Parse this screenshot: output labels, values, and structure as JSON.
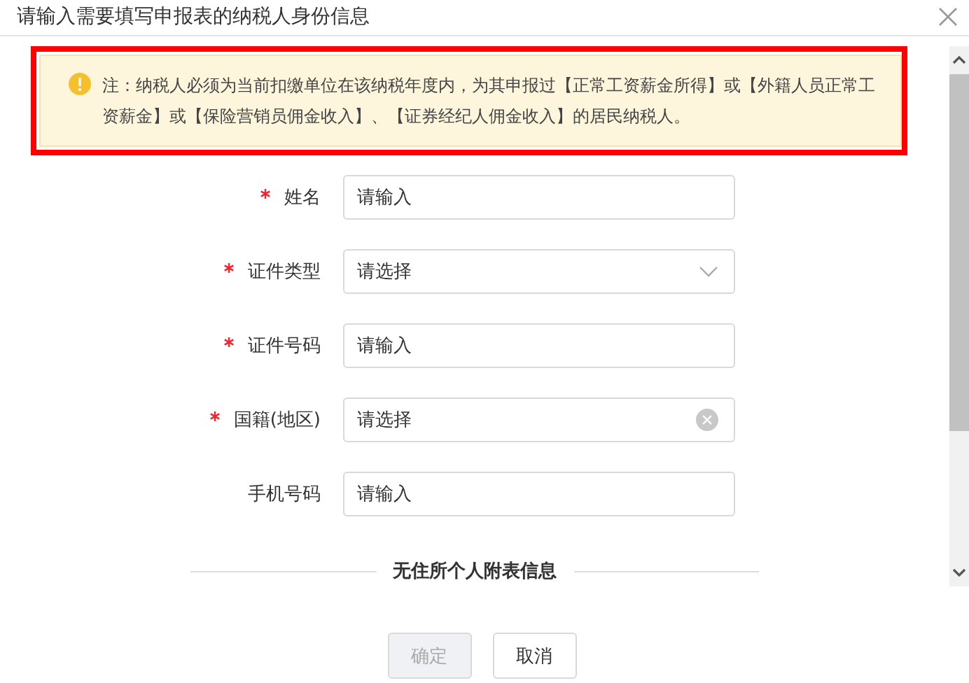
{
  "dialog": {
    "title": "请输入需要填写申报表的纳税人身份信息"
  },
  "notice": {
    "text": "注：纳税人必须为当前扣缴单位在该纳税年度内，为其申报过【正常工资薪金所得】或【外籍人员正常工资薪金】或【保险营销员佣金收入】、【证券经纪人佣金收入】的居民纳税人。",
    "highlighted": true
  },
  "fields": [
    {
      "label": "姓名",
      "required": true,
      "kind": "input",
      "placeholder": "请输入"
    },
    {
      "label": "证件类型",
      "required": true,
      "kind": "select",
      "placeholder": "请选择"
    },
    {
      "label": "证件号码",
      "required": true,
      "kind": "input",
      "placeholder": "请输入"
    },
    {
      "label": "国籍(地区)",
      "required": true,
      "kind": "select-clear",
      "placeholder": "请选择"
    },
    {
      "label": "手机号码",
      "required": false,
      "kind": "input",
      "placeholder": "请输入"
    }
  ],
  "section": {
    "title": "无住所个人附表信息"
  },
  "buttons": [
    {
      "label": "确定",
      "disabled": true
    },
    {
      "label": "取消",
      "disabled": false
    }
  ]
}
